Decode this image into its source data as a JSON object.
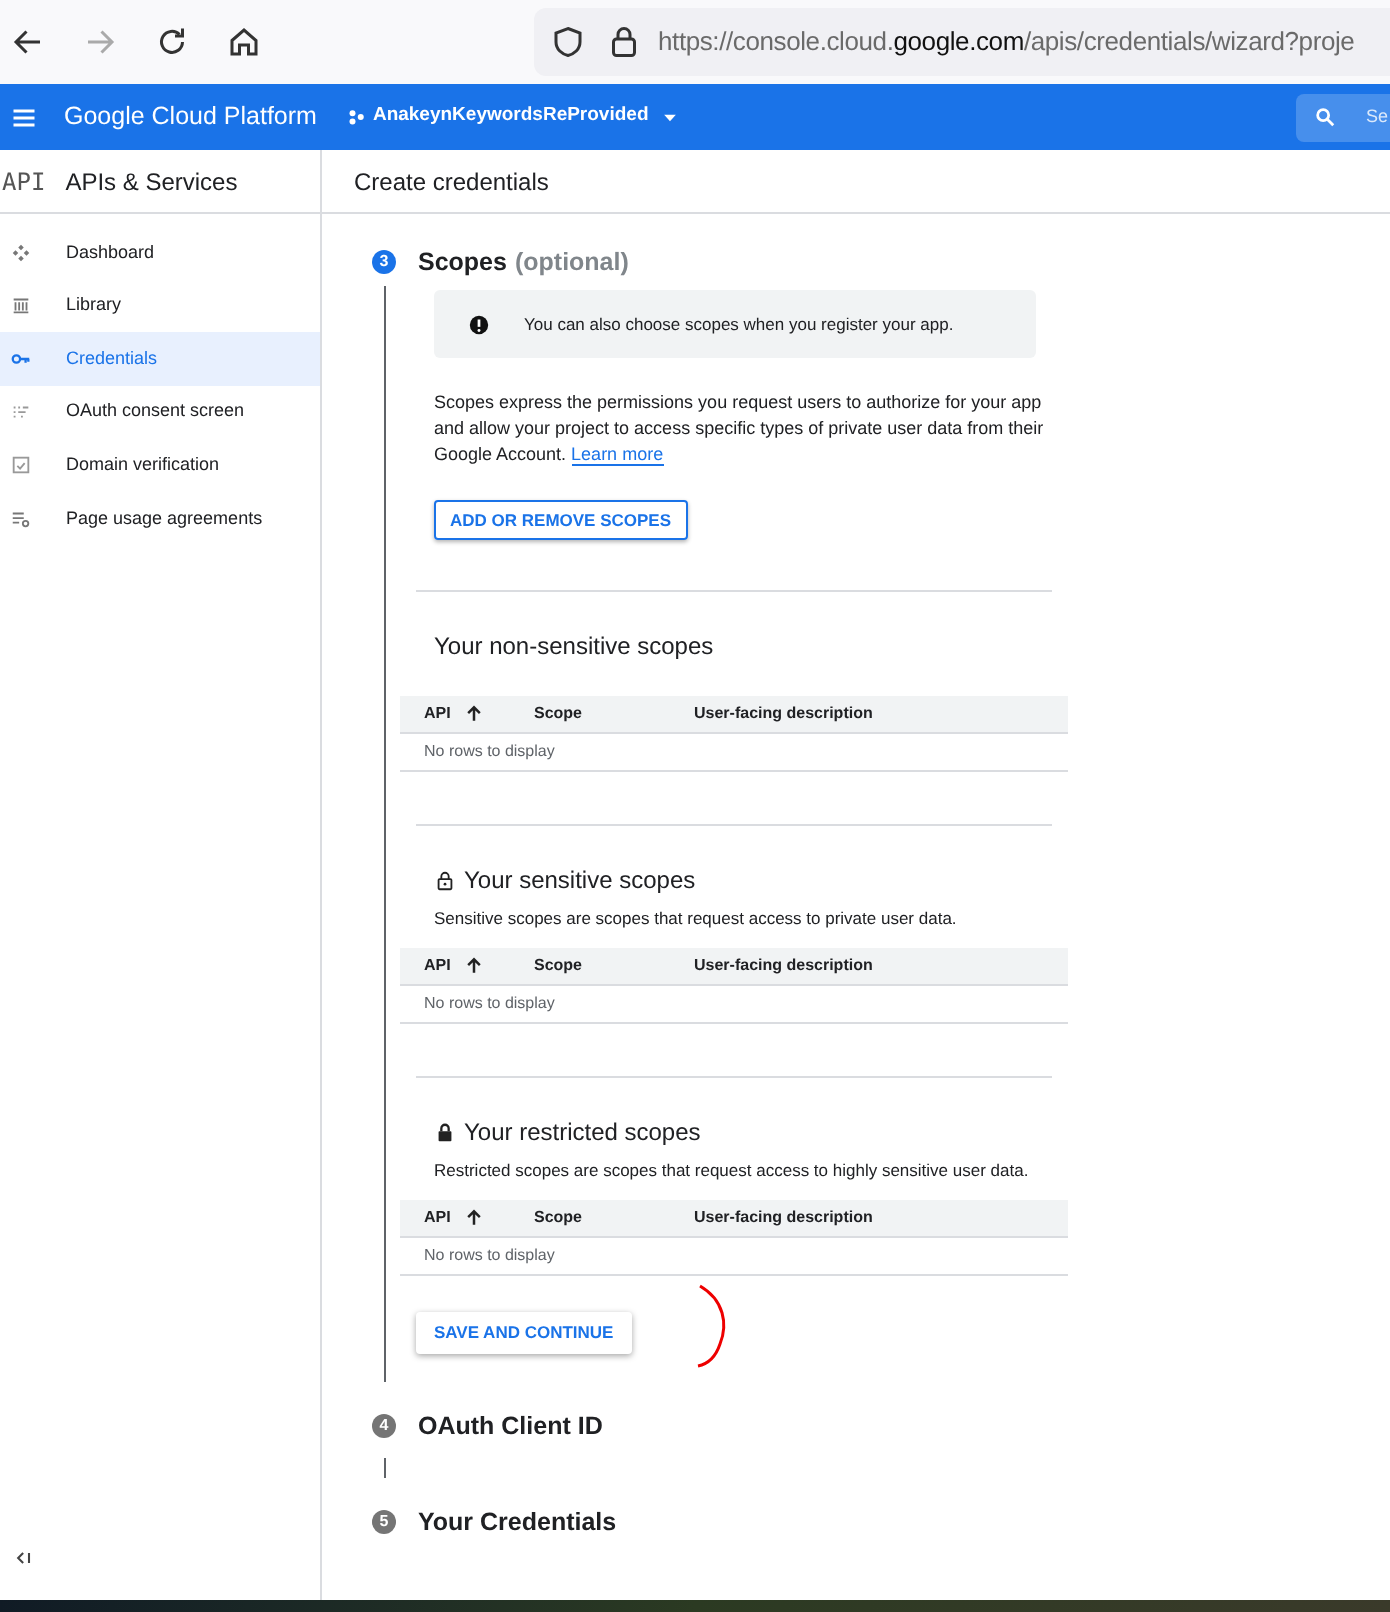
{
  "browser": {
    "url_scheme": "https://console.cloud.",
    "url_domain": "google.com",
    "url_path": "/apis/credentials/wizard?proje",
    "forward_disabled": true
  },
  "header": {
    "title": "Google Cloud Platform",
    "project": "AnakeynKeywordsReProvided",
    "search_placeholder": "Se"
  },
  "sidebar": {
    "badge": "API",
    "title": "APIs & Services",
    "items": [
      {
        "label": "Dashboard",
        "selected": false,
        "kind": "dashboard"
      },
      {
        "label": "Library",
        "selected": false,
        "kind": "library"
      },
      {
        "label": "Credentials",
        "selected": true,
        "kind": "key"
      },
      {
        "label": "OAuth consent screen",
        "selected": false,
        "kind": "consent"
      },
      {
        "label": "Domain verification",
        "selected": false,
        "kind": "domain"
      },
      {
        "label": "Page usage agreements",
        "selected": false,
        "kind": "agreements"
      }
    ]
  },
  "page_title": "Create credentials",
  "steps": [
    {
      "number": "3",
      "title": "Scopes",
      "suffix": "(optional)",
      "active": true
    },
    {
      "number": "4",
      "title": "OAuth Client ID",
      "active": false
    },
    {
      "number": "5",
      "title": "Your Credentials",
      "active": false
    }
  ],
  "scopes": {
    "info": "You can also choose scopes when you register your app.",
    "description": "Scopes express the permissions you request users to authorize for your app and allow your project to access specific types of private user data from their Google Account.",
    "link": "Learn more",
    "add_button": "ADD OR REMOVE SCOPES",
    "sections": [
      {
        "kind": "plain",
        "title": "Your non-sensitive scopes",
        "columns": [
          "API",
          "Scope",
          "User-facing description"
        ],
        "empty": "No rows to display"
      },
      {
        "kind": "sensitive",
        "title": "Your sensitive scopes",
        "description": "Sensitive scopes are scopes that request access to private user data.",
        "columns": [
          "API",
          "Scope",
          "User-facing description"
        ],
        "empty": "No rows to display"
      },
      {
        "kind": "restricted",
        "title": "Your restricted scopes",
        "description": "Restricted scopes are scopes that request access to highly sensitive user data.",
        "columns": [
          "API",
          "Scope",
          "User-facing description"
        ],
        "empty": "No rows to display"
      }
    ],
    "save_button": "SAVE AND CONTINUE"
  }
}
